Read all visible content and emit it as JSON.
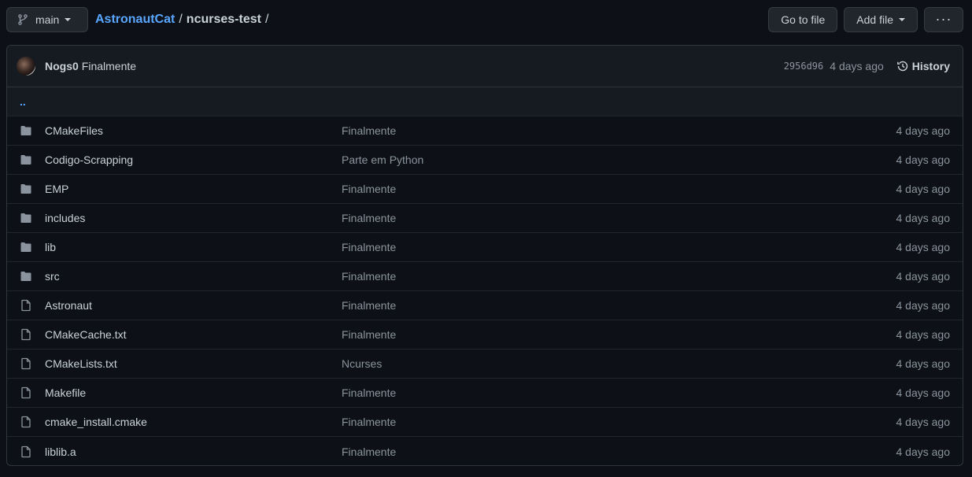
{
  "topbar": {
    "branch": "main",
    "owner": "AstronautCat",
    "repo": "ncurses-test",
    "separator": "/",
    "goto_file": "Go to file",
    "add_file": "Add file",
    "more": "···"
  },
  "commit": {
    "author": "Nogs0",
    "message": "Finalmente",
    "sha": "2956d96",
    "time": "4 days ago",
    "history_label": "History"
  },
  "parent_dir": "..",
  "files": [
    {
      "type": "folder",
      "name": "CMakeFiles",
      "message": "Finalmente",
      "age": "4 days ago"
    },
    {
      "type": "folder",
      "name": "Codigo-Scrapping",
      "message": "Parte em Python",
      "age": "4 days ago"
    },
    {
      "type": "folder",
      "name": "EMP",
      "message": "Finalmente",
      "age": "4 days ago"
    },
    {
      "type": "folder",
      "name": "includes",
      "message": "Finalmente",
      "age": "4 days ago"
    },
    {
      "type": "folder",
      "name": "lib",
      "message": "Finalmente",
      "age": "4 days ago"
    },
    {
      "type": "folder",
      "name": "src",
      "message": "Finalmente",
      "age": "4 days ago"
    },
    {
      "type": "file",
      "name": "Astronaut",
      "message": "Finalmente",
      "age": "4 days ago"
    },
    {
      "type": "file",
      "name": "CMakeCache.txt",
      "message": "Finalmente",
      "age": "4 days ago"
    },
    {
      "type": "file",
      "name": "CMakeLists.txt",
      "message": "Ncurses",
      "age": "4 days ago"
    },
    {
      "type": "file",
      "name": "Makefile",
      "message": "Finalmente",
      "age": "4 days ago"
    },
    {
      "type": "file",
      "name": "cmake_install.cmake",
      "message": "Finalmente",
      "age": "4 days ago"
    },
    {
      "type": "file",
      "name": "liblib.a",
      "message": "Finalmente",
      "age": "4 days ago"
    }
  ],
  "colors": {
    "background": "#0d1117",
    "link": "#58a6ff",
    "muted": "#8b949e",
    "icon": "#8b949e"
  }
}
